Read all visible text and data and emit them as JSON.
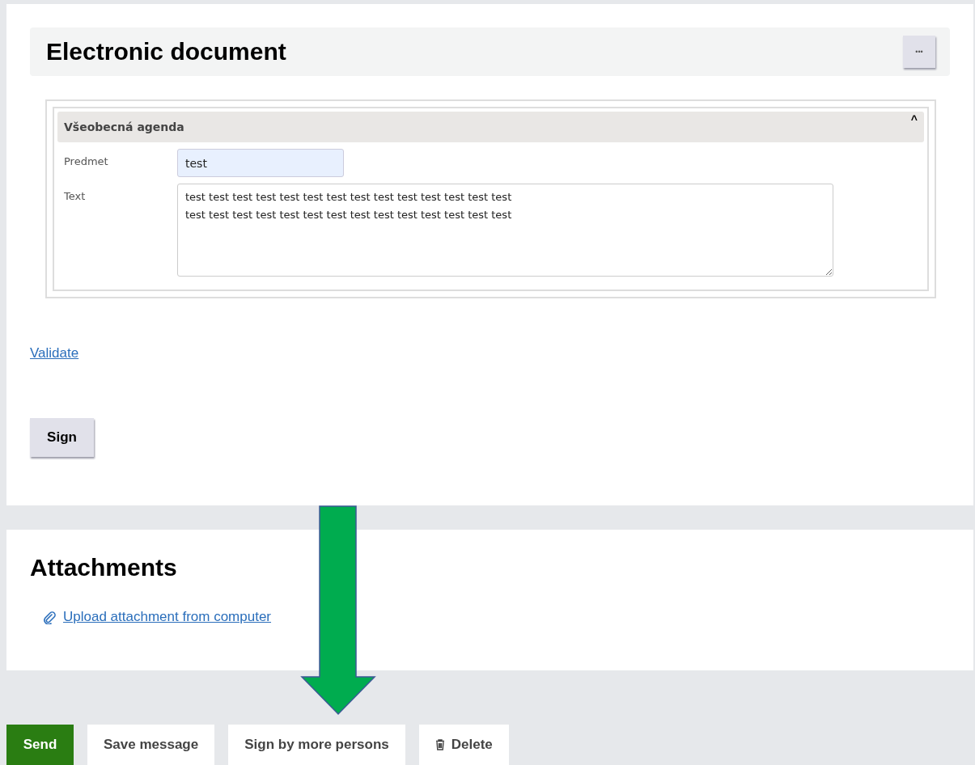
{
  "document": {
    "title": "Electronic document",
    "menu_button": "•••",
    "section": {
      "title": "Všeobecná agenda",
      "expanded": true,
      "toggle": "^",
      "fields": [
        {
          "kind": "input",
          "label": "Predmet",
          "value": "test"
        },
        {
          "kind": "textarea",
          "label": "Text",
          "value": "test test test test test test test test test test test test test test\ntest test test test test test test test test test test test test test"
        }
      ]
    },
    "validate_link": "Validate",
    "sign_button": "Sign"
  },
  "attachments": {
    "title": "Attachments",
    "upload_link": "Upload attachment from computer"
  },
  "actions": [
    {
      "kind": "primary",
      "label": "Send"
    },
    {
      "kind": "plain",
      "label": "Save message"
    },
    {
      "kind": "plain",
      "label": "Sign by more persons"
    },
    {
      "kind": "delete",
      "label": "Delete"
    }
  ],
  "annotation": {
    "kind": "arrow"
  }
}
